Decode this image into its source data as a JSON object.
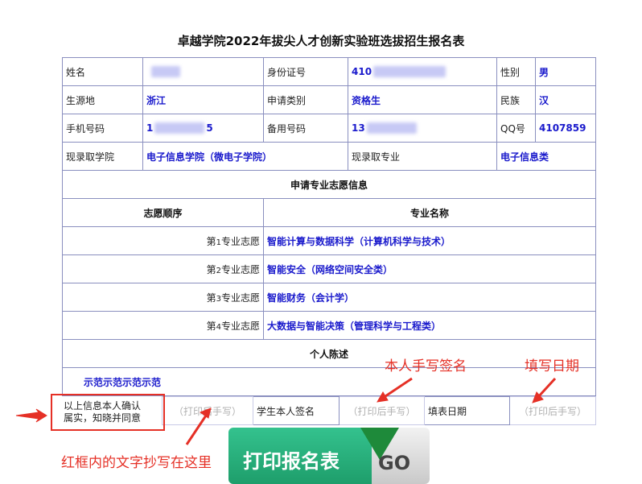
{
  "title": "卓越学院2022年拔尖人才创新实验班选拔招生报名表",
  "fields": {
    "name_label": "姓名",
    "id_label": "身份证号",
    "id_value": "410",
    "gender_label": "性别",
    "gender_value": "男",
    "origin_label": "生源地",
    "origin_value": "浙江",
    "apply_type_label": "申请类别",
    "apply_type_value": "资格生",
    "ethnic_label": "民族",
    "ethnic_value": "汉",
    "phone_label": "手机号码",
    "phone_prefix": "1",
    "phone_suffix": "5",
    "backup_label": "备用号码",
    "backup_value": "13",
    "qq_label": "QQ号",
    "qq_value": "4107859",
    "college_label": "现录取学院",
    "college_value": "电子信息学院（微电子学院）",
    "major_label": "现录取专业",
    "major_value": "电子信息类"
  },
  "wishes": {
    "section_title": "申请专业志愿信息",
    "order_header": "志愿顺序",
    "name_header": "专业名称",
    "items": [
      {
        "ord_pre": "第",
        "ord_num": "1",
        "ord_post": "专业志愿",
        "name": "智能计算与数据科学（计算机科学与技术）"
      },
      {
        "ord_pre": "第",
        "ord_num": "2",
        "ord_post": "专业志愿",
        "name": "智能安全（网络空间安全类）"
      },
      {
        "ord_pre": "第",
        "ord_num": "3",
        "ord_post": "专业志愿",
        "name": "智能财务（会计学）"
      },
      {
        "ord_pre": "第",
        "ord_num": "4",
        "ord_post": "专业志愿",
        "name": "大数据与智能决策（管理科学与工程类）"
      }
    ]
  },
  "statement": {
    "section_title": "个人陈述",
    "sample_text": "示范示范示范示范"
  },
  "signature": {
    "confirm_text_1": "以上信息本人确认",
    "confirm_text_2": "属实，知晓并同意",
    "placeholder": "（打印后手写）",
    "student_sign_label": "学生本人签名",
    "date_label": "填表日期"
  },
  "annotations": {
    "sign_hint": "本人手写签名",
    "date_hint": "填写日期",
    "copy_hint": "红框内的文字抄写在这里"
  },
  "print_button": {
    "label": "打印报名表",
    "go": "GO"
  },
  "colors": {
    "accent_text": "#1a1acc",
    "annotation_red": "#e53026",
    "button_green": "#1e9e6b"
  }
}
